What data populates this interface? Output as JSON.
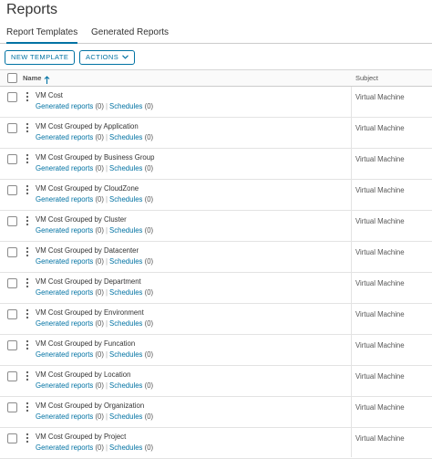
{
  "page": {
    "title": "Reports"
  },
  "tabs": [
    {
      "label": "Report Templates",
      "active": true
    },
    {
      "label": "Generated Reports",
      "active": false
    }
  ],
  "toolbar": {
    "new_label": "NEW TEMPLATE",
    "actions_label": "ACTIONS"
  },
  "grid": {
    "col_name": "Name",
    "col_subject": "Subject",
    "rows": [
      {
        "name": "VM Cost",
        "generated_label": "Generated reports",
        "generated_count": "(0)",
        "schedules_label": "Schedules",
        "schedules_count": "(0)",
        "subject": "Virtual Machine"
      },
      {
        "name": "VM Cost Grouped by Application",
        "generated_label": "Generated reports",
        "generated_count": "(0)",
        "schedules_label": "Schedules",
        "schedules_count": "(0)",
        "subject": "Virtual Machine"
      },
      {
        "name": "VM Cost Grouped by Business Group",
        "generated_label": "Generated reports",
        "generated_count": "(0)",
        "schedules_label": "Schedules",
        "schedules_count": "(0)",
        "subject": "Virtual Machine"
      },
      {
        "name": "VM Cost Grouped by CloudZone",
        "generated_label": "Generated reports",
        "generated_count": "(0)",
        "schedules_label": "Schedules",
        "schedules_count": "(0)",
        "subject": "Virtual Machine"
      },
      {
        "name": "VM Cost Grouped by Cluster",
        "generated_label": "Generated reports",
        "generated_count": "(0)",
        "schedules_label": "Schedules",
        "schedules_count": "(0)",
        "subject": "Virtual Machine"
      },
      {
        "name": "VM Cost Grouped by Datacenter",
        "generated_label": "Generated reports",
        "generated_count": "(0)",
        "schedules_label": "Schedules",
        "schedules_count": "(0)",
        "subject": "Virtual Machine"
      },
      {
        "name": "VM Cost Grouped by Department",
        "generated_label": "Generated reports",
        "generated_count": "(0)",
        "schedules_label": "Schedules",
        "schedules_count": "(0)",
        "subject": "Virtual Machine"
      },
      {
        "name": "VM Cost Grouped by Environment",
        "generated_label": "Generated reports",
        "generated_count": "(0)",
        "schedules_label": "Schedules",
        "schedules_count": "(0)",
        "subject": "Virtual Machine"
      },
      {
        "name": "VM Cost Grouped by Funcation",
        "generated_label": "Generated reports",
        "generated_count": "(0)",
        "schedules_label": "Schedules",
        "schedules_count": "(0)",
        "subject": "Virtual Machine"
      },
      {
        "name": "VM Cost Grouped by Location",
        "generated_label": "Generated reports",
        "generated_count": "(0)",
        "schedules_label": "Schedules",
        "schedules_count": "(0)",
        "subject": "Virtual Machine"
      },
      {
        "name": "VM Cost Grouped by Organization",
        "generated_label": "Generated reports",
        "generated_count": "(0)",
        "schedules_label": "Schedules",
        "schedules_count": "(0)",
        "subject": "Virtual Machine"
      },
      {
        "name": "VM Cost Grouped by Project",
        "generated_label": "Generated reports",
        "generated_count": "(0)",
        "schedules_label": "Schedules",
        "schedules_count": "(0)",
        "subject": "Virtual Machine"
      }
    ]
  },
  "icons": {
    "sort": "arrow-up-icon",
    "kebab": "kebab-menu-icon",
    "chevron": "chevron-down-icon"
  },
  "colors": {
    "link": "#0072a3",
    "text": "#333333",
    "border": "#e3e3e3"
  }
}
